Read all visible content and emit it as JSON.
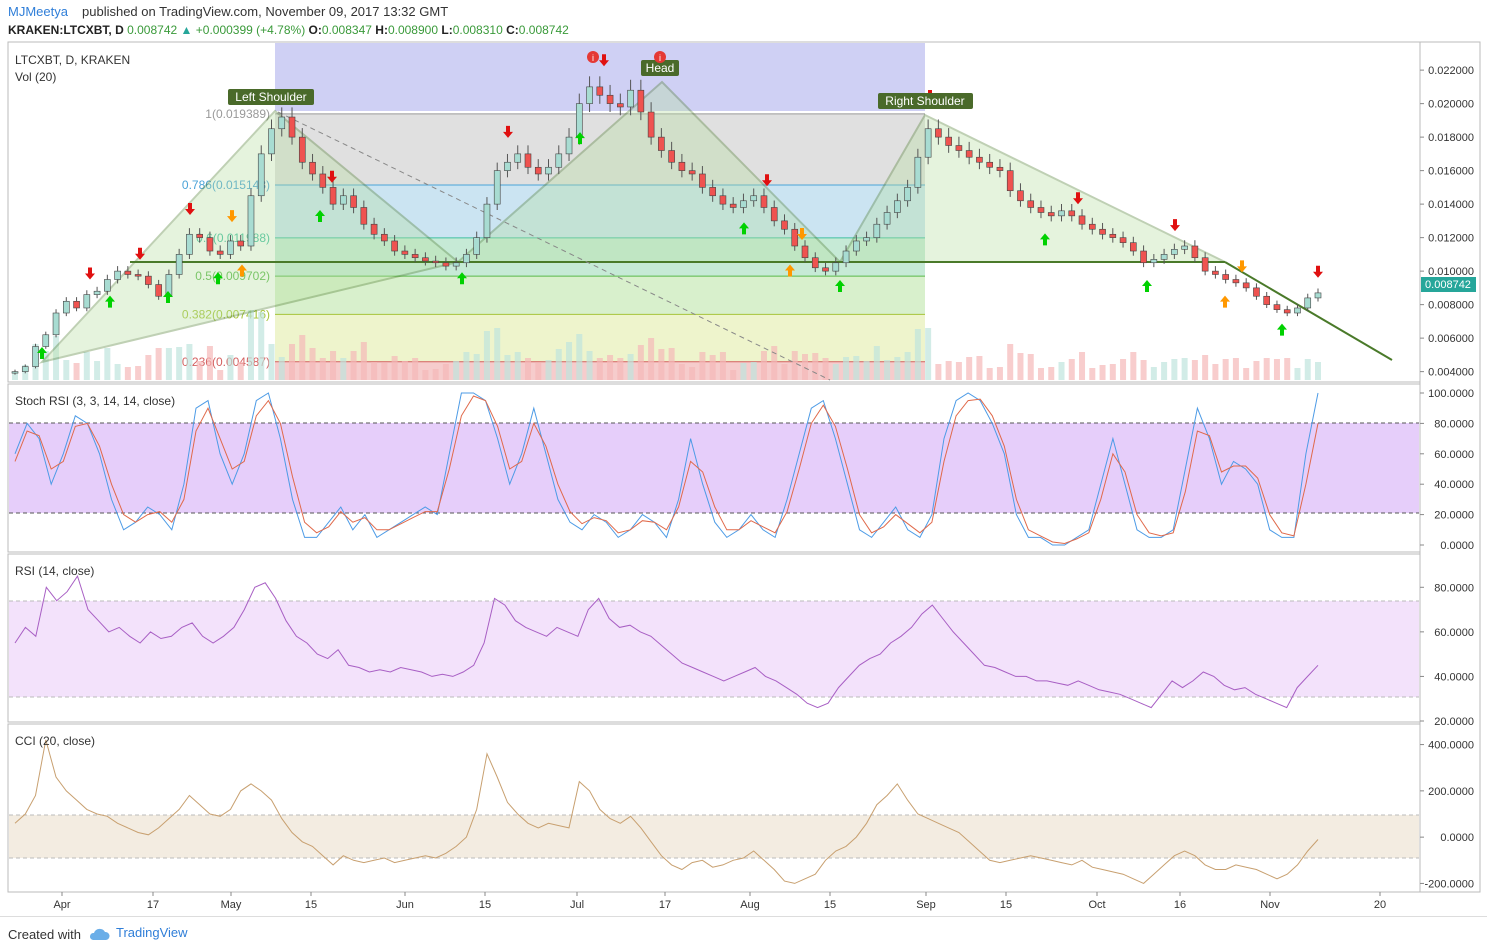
{
  "header": {
    "author": "MJMeetya",
    "published": "published on TradingView.com, November 09, 2017 13:32 GMT"
  },
  "quote": {
    "symbol": "KRAKEN:LTCXBT, D",
    "price": "0.008742",
    "change": "+0.000399 (+4.78%)",
    "open_label": "O:",
    "open": "0.008347",
    "high_label": "H:",
    "high": "0.008900",
    "low_label": "L:",
    "low": "0.008310",
    "close_label": "C:",
    "close": "0.008742"
  },
  "footer": {
    "created_with": "Created with",
    "brand": "TradingView"
  },
  "colors": {
    "up": "#26a69a",
    "down": "#ef5350",
    "pattern": "#4a7a2a",
    "accent": "#2f7ed8"
  },
  "chart_data": [
    {
      "type": "candlestick",
      "title": "LTCXBT, D, KRAKEN",
      "subtitle": "Vol (20)",
      "xlabel": "",
      "ylabel": "",
      "ylim": [
        0.0035,
        0.0235
      ],
      "y_ticks": [
        "0.022000",
        "0.020000",
        "0.018000",
        "0.016000",
        "0.014000",
        "0.012000",
        "0.010000",
        "0.008000",
        "0.006000",
        "0.004000"
      ],
      "x_ticks": [
        "Apr",
        "17",
        "May",
        "15",
        "Jun",
        "15",
        "Jul",
        "17",
        "Aug",
        "15",
        "Sep",
        "15",
        "Oct",
        "16",
        "Nov",
        "20"
      ],
      "last_price_label": "0.008742",
      "closes": [
        0.004,
        0.0043,
        0.0055,
        0.0062,
        0.0075,
        0.0082,
        0.0078,
        0.0086,
        0.0088,
        0.0095,
        0.01,
        0.0098,
        0.0097,
        0.0092,
        0.0085,
        0.0098,
        0.011,
        0.0122,
        0.012,
        0.0112,
        0.011,
        0.0118,
        0.0115,
        0.0145,
        0.017,
        0.0185,
        0.0192,
        0.018,
        0.0165,
        0.0158,
        0.015,
        0.014,
        0.0145,
        0.0138,
        0.0128,
        0.0122,
        0.0118,
        0.0112,
        0.011,
        0.0108,
        0.0106,
        0.0105,
        0.0103,
        0.0105,
        0.011,
        0.012,
        0.014,
        0.016,
        0.0165,
        0.017,
        0.0162,
        0.0158,
        0.0162,
        0.017,
        0.018,
        0.02,
        0.021,
        0.0205,
        0.02,
        0.0198,
        0.0208,
        0.0195,
        0.018,
        0.0172,
        0.0165,
        0.016,
        0.0158,
        0.015,
        0.0145,
        0.014,
        0.0138,
        0.0142,
        0.0145,
        0.0138,
        0.013,
        0.0125,
        0.0115,
        0.0108,
        0.0102,
        0.01,
        0.0105,
        0.0112,
        0.0118,
        0.012,
        0.0128,
        0.0135,
        0.0142,
        0.015,
        0.0168,
        0.0185,
        0.018,
        0.0175,
        0.0172,
        0.0168,
        0.0165,
        0.0162,
        0.016,
        0.0148,
        0.0142,
        0.0138,
        0.0135,
        0.0133,
        0.0136,
        0.0133,
        0.0128,
        0.0125,
        0.0122,
        0.012,
        0.0117,
        0.0112,
        0.0105,
        0.0107,
        0.011,
        0.0113,
        0.0115,
        0.0108,
        0.01,
        0.0098,
        0.0095,
        0.0093,
        0.009,
        0.0085,
        0.008,
        0.0077,
        0.0075,
        0.0078,
        0.0084,
        0.0087
      ],
      "fib_levels": [
        {
          "label": "1(0.019389)",
          "value": 0.019389
        },
        {
          "label": "0.786(0.015143)",
          "value": 0.015143
        },
        {
          "label": "0.6(0.011988)",
          "value": 0.011988
        },
        {
          "label": "0.5(0.009702)",
          "value": 0.009702
        },
        {
          "label": "0.382(0.007416)",
          "value": 0.007416
        },
        {
          "label": "0.236(0.004587)",
          "value": 0.004587
        }
      ],
      "annotations": [
        "Left Shoulder",
        "Head",
        "Right Shoulder"
      ]
    },
    {
      "type": "line",
      "title": "Stoch RSI (3, 3, 14, 14, close)",
      "ylim": [
        0,
        100
      ],
      "y_ticks": [
        "100.0000",
        "80.0000",
        "60.0000",
        "40.0000",
        "20.0000",
        "0.0000"
      ],
      "band": [
        20,
        80
      ],
      "k": [
        60,
        80,
        70,
        40,
        60,
        85,
        80,
        60,
        30,
        10,
        15,
        25,
        20,
        10,
        40,
        90,
        95,
        60,
        40,
        60,
        95,
        100,
        70,
        30,
        5,
        5,
        15,
        25,
        10,
        20,
        5,
        10,
        15,
        20,
        25,
        20,
        60,
        100,
        100,
        95,
        70,
        40,
        60,
        90,
        60,
        30,
        15,
        10,
        20,
        15,
        5,
        10,
        20,
        15,
        5,
        30,
        70,
        40,
        15,
        5,
        10,
        20,
        10,
        5,
        30,
        60,
        90,
        95,
        70,
        40,
        10,
        5,
        15,
        25,
        10,
        5,
        20,
        70,
        95,
        100,
        95,
        80,
        60,
        20,
        5,
        5,
        0,
        0,
        5,
        10,
        40,
        70,
        40,
        10,
        5,
        5,
        10,
        50,
        90,
        70,
        40,
        55,
        50,
        40,
        10,
        5,
        5,
        60,
        100
      ],
      "d": [
        55,
        75,
        72,
        50,
        55,
        78,
        80,
        65,
        40,
        20,
        15,
        20,
        22,
        15,
        30,
        75,
        90,
        70,
        50,
        55,
        85,
        95,
        80,
        45,
        15,
        8,
        12,
        22,
        15,
        18,
        10,
        10,
        14,
        18,
        22,
        22,
        50,
        85,
        98,
        95,
        78,
        50,
        55,
        80,
        65,
        40,
        22,
        14,
        18,
        16,
        8,
        10,
        16,
        15,
        10,
        25,
        55,
        48,
        25,
        10,
        10,
        16,
        12,
        8,
        22,
        50,
        80,
        92,
        78,
        50,
        20,
        8,
        12,
        20,
        14,
        8,
        15,
        55,
        85,
        95,
        96,
        85,
        65,
        30,
        10,
        6,
        2,
        1,
        4,
        8,
        30,
        60,
        48,
        20,
        8,
        6,
        8,
        35,
        75,
        72,
        48,
        52,
        52,
        44,
        20,
        8,
        6,
        40,
        80
      ]
    },
    {
      "type": "line",
      "title": "RSI (14, close)",
      "ylim": [
        20,
        90
      ],
      "y_ticks": [
        "80.0000",
        "60.0000",
        "40.0000",
        "20.0000"
      ],
      "band": [
        30,
        70
      ],
      "values": [
        55,
        62,
        58,
        80,
        74,
        78,
        85,
        70,
        65,
        60,
        62,
        58,
        55,
        60,
        57,
        58,
        62,
        64,
        58,
        55,
        58,
        62,
        70,
        80,
        82,
        75,
        65,
        58,
        55,
        50,
        48,
        52,
        45,
        44,
        42,
        43,
        42,
        44,
        43,
        42,
        40,
        41,
        40,
        42,
        45,
        55,
        75,
        72,
        65,
        62,
        60,
        58,
        62,
        60,
        58,
        70,
        75,
        66,
        62,
        63,
        60,
        58,
        54,
        50,
        46,
        44,
        42,
        40,
        38,
        40,
        42,
        44,
        40,
        38,
        35,
        32,
        28,
        26,
        28,
        35,
        40,
        45,
        48,
        50,
        55,
        58,
        62,
        68,
        72,
        66,
        60,
        55,
        50,
        45,
        44,
        42,
        40,
        40,
        38,
        38,
        37,
        36,
        38,
        36,
        34,
        33,
        32,
        30,
        28,
        26,
        32,
        38,
        35,
        38,
        42,
        40,
        36,
        34,
        35,
        32,
        30,
        28,
        26,
        35,
        40,
        45
      ]
    },
    {
      "type": "line",
      "title": "CCI (20, close)",
      "ylim": [
        -250,
        450
      ],
      "y_ticks": [
        "400.0000",
        "200.0000",
        "0.0000",
        "-200.0000"
      ],
      "band": [
        -100,
        100
      ],
      "values": [
        60,
        100,
        180,
        420,
        260,
        200,
        160,
        120,
        100,
        90,
        60,
        40,
        20,
        10,
        40,
        80,
        120,
        180,
        140,
        100,
        90,
        120,
        200,
        230,
        200,
        160,
        80,
        20,
        -20,
        -40,
        -80,
        -120,
        -80,
        -100,
        -110,
        -100,
        -90,
        -110,
        -100,
        -90,
        -80,
        -90,
        -70,
        -40,
        0,
        120,
        360,
        260,
        150,
        100,
        60,
        40,
        60,
        50,
        40,
        240,
        200,
        120,
        80,
        60,
        90,
        40,
        -20,
        -80,
        -120,
        -140,
        -110,
        -100,
        -130,
        -120,
        -100,
        -90,
        -60,
        -100,
        -140,
        -190,
        -200,
        -180,
        -160,
        -100,
        -60,
        -40,
        0,
        60,
        140,
        180,
        230,
        160,
        100,
        80,
        60,
        40,
        20,
        -20,
        -60,
        -100,
        -110,
        -100,
        -90,
        -80,
        -90,
        -100,
        -110,
        -120,
        -100,
        -130,
        -140,
        -150,
        -160,
        -180,
        -200,
        -160,
        -120,
        -80,
        -60,
        -80,
        -120,
        -140,
        -140,
        -120,
        -130,
        -140,
        -160,
        -180,
        -160,
        -120,
        -60,
        -10
      ]
    }
  ]
}
